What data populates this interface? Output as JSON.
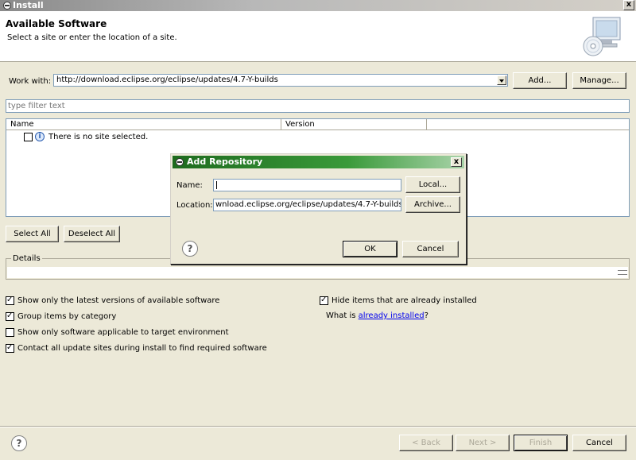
{
  "window": {
    "title": "Install",
    "close_label": "x"
  },
  "header": {
    "title": "Available Software",
    "subtitle": "Select a site or enter the location of a site."
  },
  "work_with": {
    "label": "Work with:",
    "value": "http://download.eclipse.org/eclipse/updates/4.7-Y-builds",
    "add_label": "Add...",
    "manage_label": "Manage..."
  },
  "filter": {
    "placeholder": "type filter text"
  },
  "tree": {
    "columns": [
      "Name",
      "Version"
    ],
    "rows": [
      {
        "text": "There is no site selected."
      }
    ]
  },
  "selection_buttons": {
    "select_all": "Select All",
    "deselect_all": "Deselect All"
  },
  "details": {
    "label": "Details"
  },
  "options": {
    "latest_versions": {
      "label": "Show only the latest versions of available software",
      "checked": true
    },
    "group_by_category": {
      "label": "Group items by category",
      "checked": true
    },
    "applicable_only": {
      "label": "Show only software applicable to target environment",
      "checked": false
    },
    "contact_sites": {
      "label": "Contact all update sites during install to find required software",
      "checked": true
    },
    "hide_installed": {
      "label": "Hide items that are already installed",
      "checked": true
    },
    "what_is_prefix": "What is ",
    "what_is_link": "already installed",
    "what_is_suffix": "?"
  },
  "footer": {
    "help": "?",
    "back": "< Back",
    "next": "Next >",
    "finish": "Finish",
    "cancel": "Cancel"
  },
  "dialog": {
    "title": "Add Repository",
    "close_label": "x",
    "name_label": "Name:",
    "name_value": "",
    "location_label": "Location:",
    "location_value": "wnload.eclipse.org/eclipse/updates/4.7-Y-builds",
    "local_label": "Local...",
    "archive_label": "Archive...",
    "help": "?",
    "ok_label": "OK",
    "cancel_label": "Cancel"
  }
}
